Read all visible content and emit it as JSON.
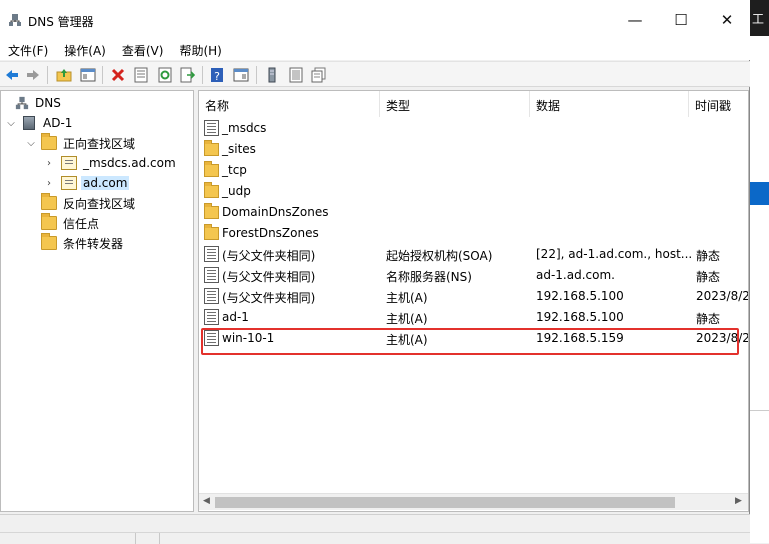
{
  "window": {
    "title": "DNS 管理器",
    "controls": {
      "minimize": "—",
      "maximize": "☐",
      "close": "✕"
    }
  },
  "background_window_text": "工",
  "menu": [
    "文件(F)",
    "操作(A)",
    "查看(V)",
    "帮助(H)"
  ],
  "toolbar": {
    "buttons": [
      "back-icon",
      "forward-icon",
      "up-folder-icon",
      "show-hide-tree-icon",
      "delete-icon",
      "properties-icon",
      "refresh-icon",
      "export-list-icon",
      "help-icon",
      "console-view-icon",
      "server-icon",
      "list-icon",
      "records-icon"
    ]
  },
  "tree": {
    "root": "DNS",
    "server": "AD-1",
    "forward_zones": "正向查找区域",
    "zones": [
      "_msdcs.ad.com",
      "ad.com"
    ],
    "selected_zone": "ad.com",
    "reverse_zones": "反向查找区域",
    "trust_points": "信任点",
    "conditional_forwarders": "条件转发器"
  },
  "list": {
    "columns": [
      "名称",
      "类型",
      "数据",
      "时间戳"
    ],
    "rows": [
      {
        "kind": "folder-zone",
        "name": "_msdcs",
        "type": "",
        "data": "",
        "timestamp": ""
      },
      {
        "kind": "folder",
        "name": "_sites",
        "type": "",
        "data": "",
        "timestamp": ""
      },
      {
        "kind": "folder",
        "name": "_tcp",
        "type": "",
        "data": "",
        "timestamp": ""
      },
      {
        "kind": "folder",
        "name": "_udp",
        "type": "",
        "data": "",
        "timestamp": ""
      },
      {
        "kind": "folder",
        "name": "DomainDnsZones",
        "type": "",
        "data": "",
        "timestamp": ""
      },
      {
        "kind": "folder",
        "name": "ForestDnsZones",
        "type": "",
        "data": "",
        "timestamp": ""
      },
      {
        "kind": "record",
        "name": "(与父文件夹相同)",
        "type": "起始授权机构(SOA)",
        "data": "[22], ad-1.ad.com., host...",
        "timestamp": "静态"
      },
      {
        "kind": "record",
        "name": "(与父文件夹相同)",
        "type": "名称服务器(NS)",
        "data": "ad-1.ad.com.",
        "timestamp": "静态"
      },
      {
        "kind": "record",
        "name": "(与父文件夹相同)",
        "type": "主机(A)",
        "data": "192.168.5.100",
        "timestamp": "2023/8/2"
      },
      {
        "kind": "record",
        "name": "ad-1",
        "type": "主机(A)",
        "data": "192.168.5.100",
        "timestamp": "静态"
      },
      {
        "kind": "record",
        "name": "win-10-1",
        "type": "主机(A)",
        "data": "192.168.5.159",
        "timestamp": "2023/8/2"
      }
    ]
  },
  "colors": {
    "highlight_box": "#e3312c",
    "selection": "#cce8ff",
    "accent_blue": "#0b68c8"
  }
}
